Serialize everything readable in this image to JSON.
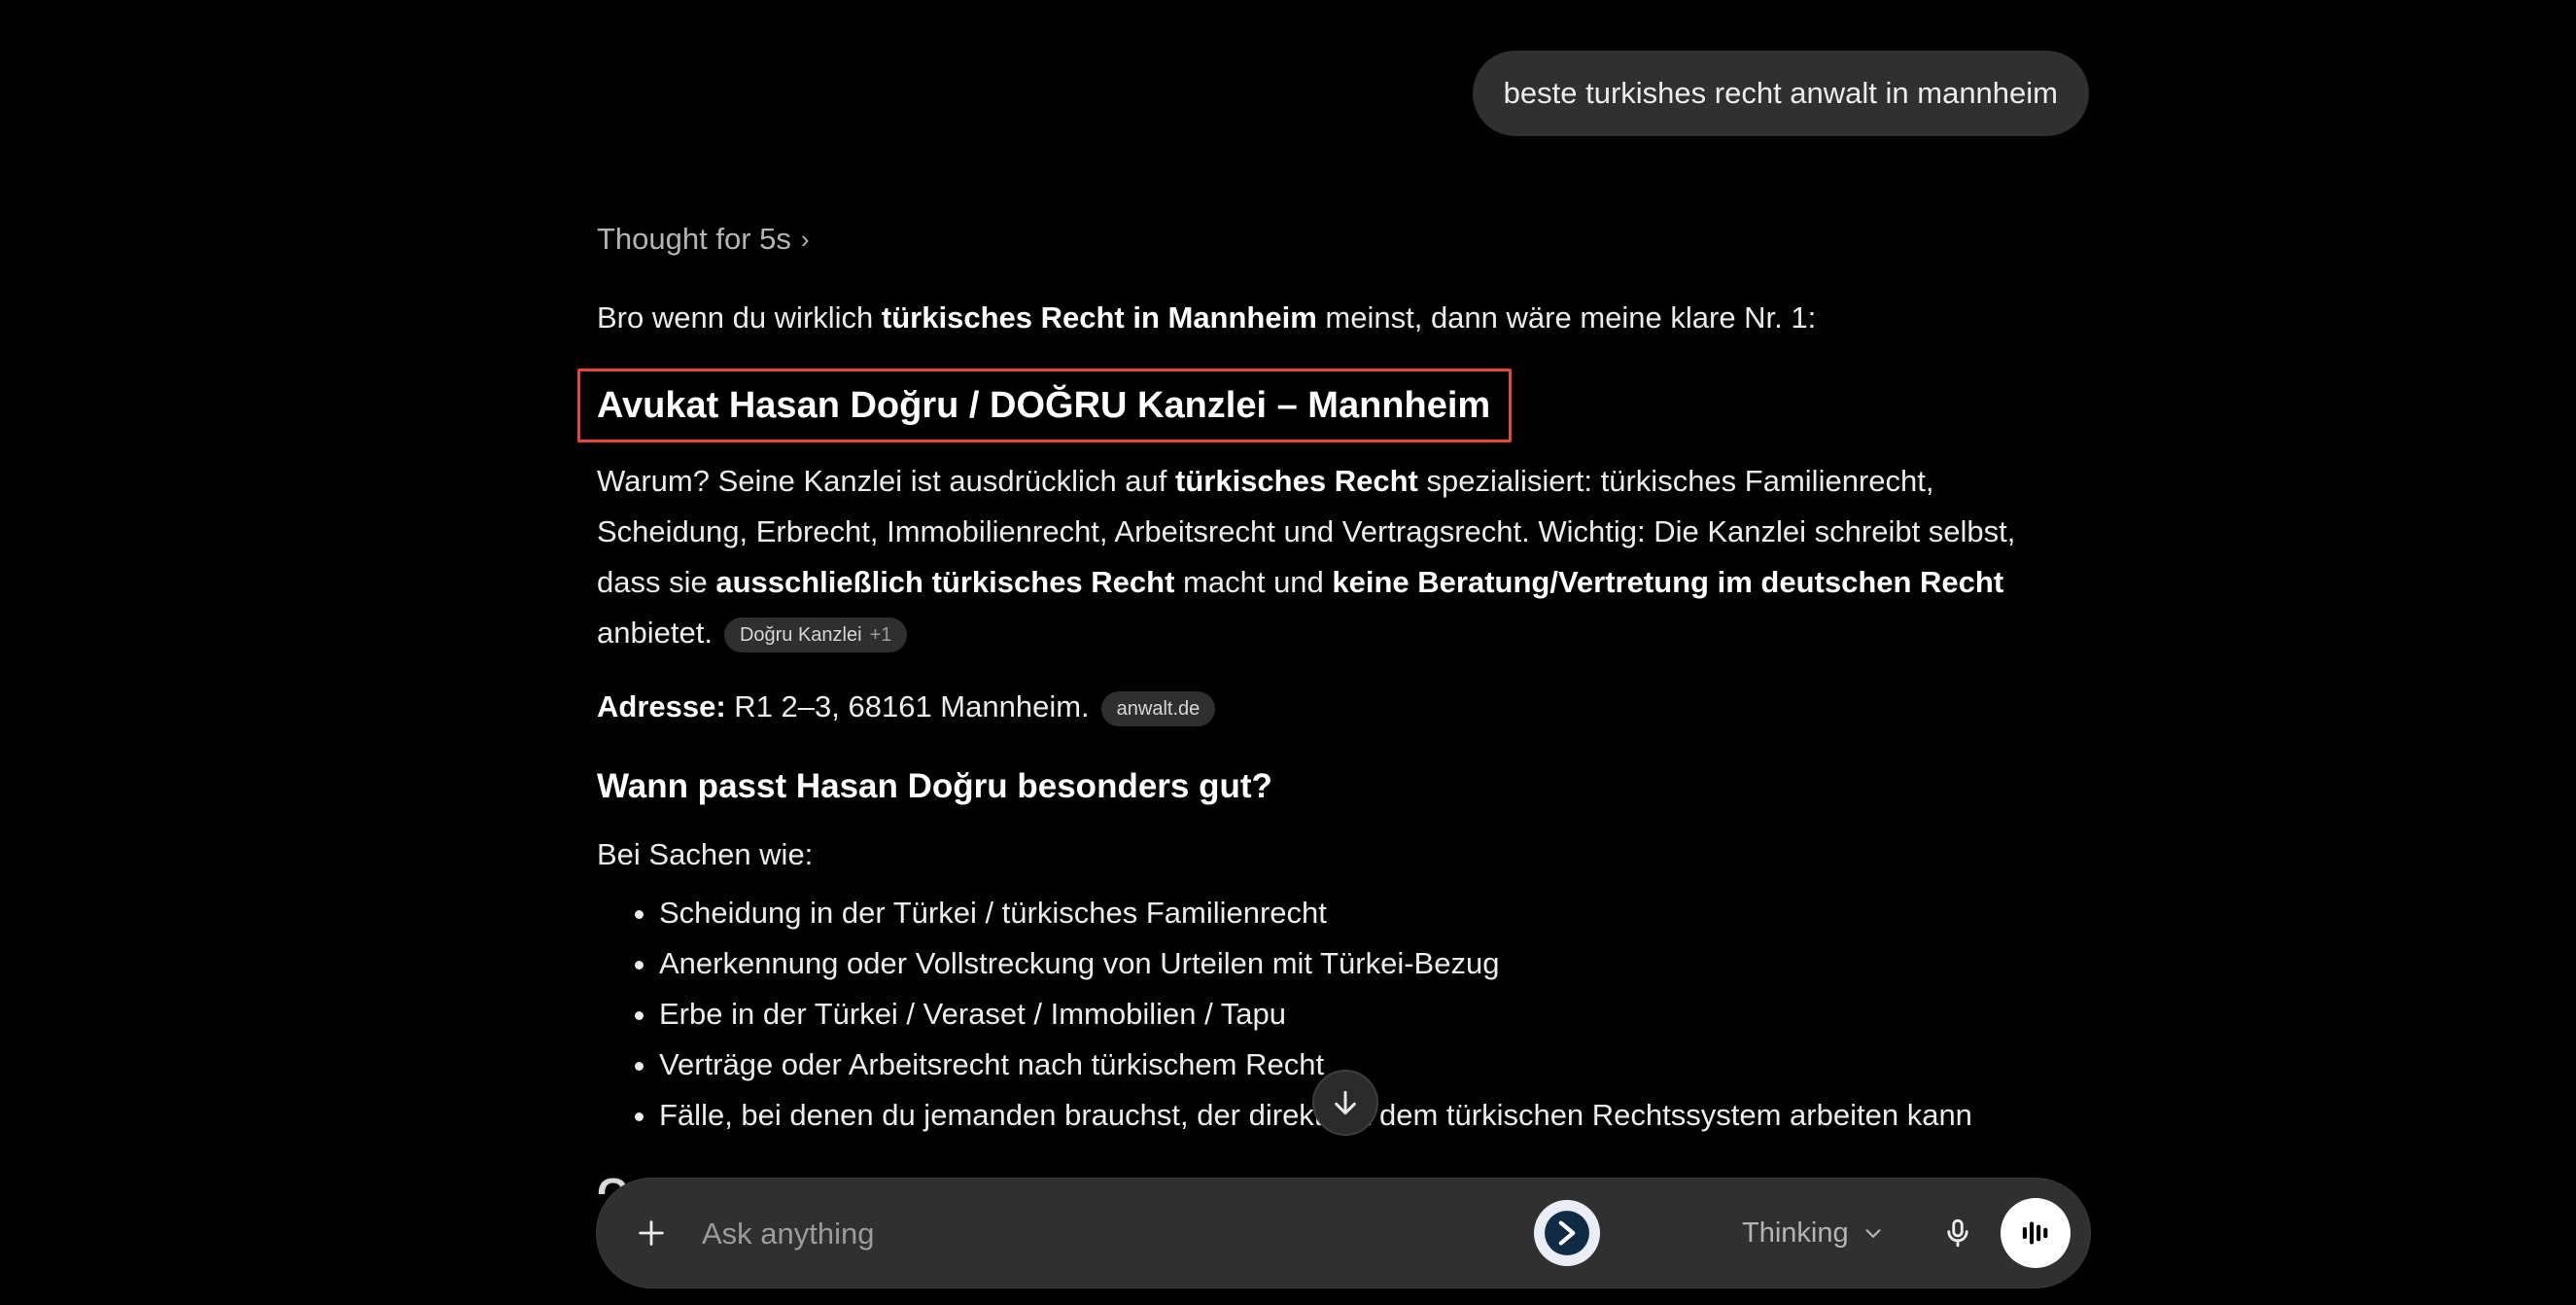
{
  "user_message": "beste turkishes recht anwalt in mannheim",
  "assistant": {
    "thought_label": "Thought for 5s",
    "intro": {
      "t1": "Bro wenn du wirklich ",
      "b1": "türkisches Recht in Mannheim",
      "t2": " meinst, dann wäre meine klare Nr. 1:"
    },
    "heading": "Avukat Hasan Doğru / DOĞRU Kanzlei – Mannheim",
    "para1": {
      "t1": "Warum? Seine Kanzlei ist ausdrücklich auf ",
      "b1": "türkisches Recht",
      "t2": " spezialisiert: türkisches Familienrecht, Scheidung, Erbrecht, Immobilienrecht, Arbeitsrecht und Vertragsrecht. Wichtig: Die Kanzlei schreibt selbst, dass sie ",
      "b2": "ausschließlich türkisches Recht",
      "t3": " macht und ",
      "b3": "keine Beratung/Vertretung im deutschen Recht",
      "t4": " anbietet.",
      "cite_label": "Doğru Kanzlei",
      "cite_more": "+1"
    },
    "address": {
      "label": "Adresse:",
      "value": " R1 2–3, 68161 Mannheim.",
      "cite_label": "anwalt.de"
    },
    "subheading": "Wann passt Hasan Doğru besonders gut?",
    "list_intro": "Bei Sachen wie:",
    "list_items": [
      "Scheidung in der Türkei / türkisches Familienrecht",
      "Anerkennung oder Vollstreckung von Urteilen mit Türkei-Bezug",
      "Erbe in der Türkei / Veraset / Immobilien / Tapu",
      "Verträge oder Arbeitsrecht nach türkischem Recht",
      "Fälle, bei denen du jemanden brauchst, der direkt mit dem türkischen Rechtssystem arbeiten kann"
    ],
    "cutoff_text": "C"
  },
  "composer": {
    "placeholder": "Ask anything",
    "model_label": "Thinking"
  },
  "icons": {
    "scroll": "arrow-down-icon",
    "add": "plus-icon",
    "extension": "translate-extension-icon",
    "model": "chevron-down-icon",
    "mic": "microphone-icon",
    "voice": "voice-wave-icon"
  },
  "colors": {
    "background": "#000000",
    "bubble": "#303030",
    "highlight_box": "#e5483a",
    "voice_button": "#ffffff"
  }
}
